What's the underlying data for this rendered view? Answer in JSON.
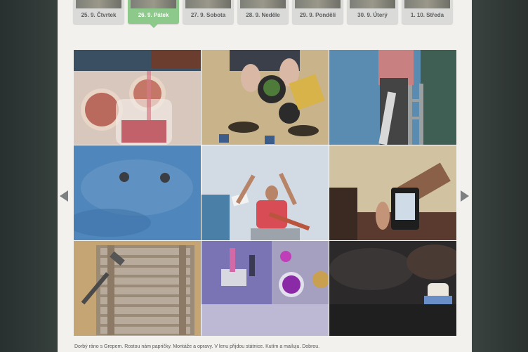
{
  "tabs": [
    {
      "label": "25. 9. Čtvrtek",
      "active": false
    },
    {
      "label": "26. 9. Pátek",
      "active": true
    },
    {
      "label": "27. 9. Sobota",
      "active": false
    },
    {
      "label": "28. 9. Neděle",
      "active": false
    },
    {
      "label": "29. 9. Pondělí",
      "active": false
    },
    {
      "label": "30. 9. Úterý",
      "active": false
    },
    {
      "label": "1. 10. Středa",
      "active": false
    }
  ],
  "photos": [
    "grapefruit-juice-photo",
    "planting-pepper-photo",
    "ladder-repair-photo",
    "blue-wall-photo",
    "man-on-ladder-photo",
    "e-reader-photo",
    "wooden-boards-hammer-photo",
    "paint-brushes-photo",
    "evening-rest-photo"
  ],
  "nav": {
    "prev_icon": "arrow-left-icon",
    "next_icon": "arrow-right-icon"
  },
  "caption": "Dorbý ráno s Grepem. Rostou nám papričky. Montáže a opravy. V lenu přijdou státnice. Kutím a mailuju. Dobrou."
}
